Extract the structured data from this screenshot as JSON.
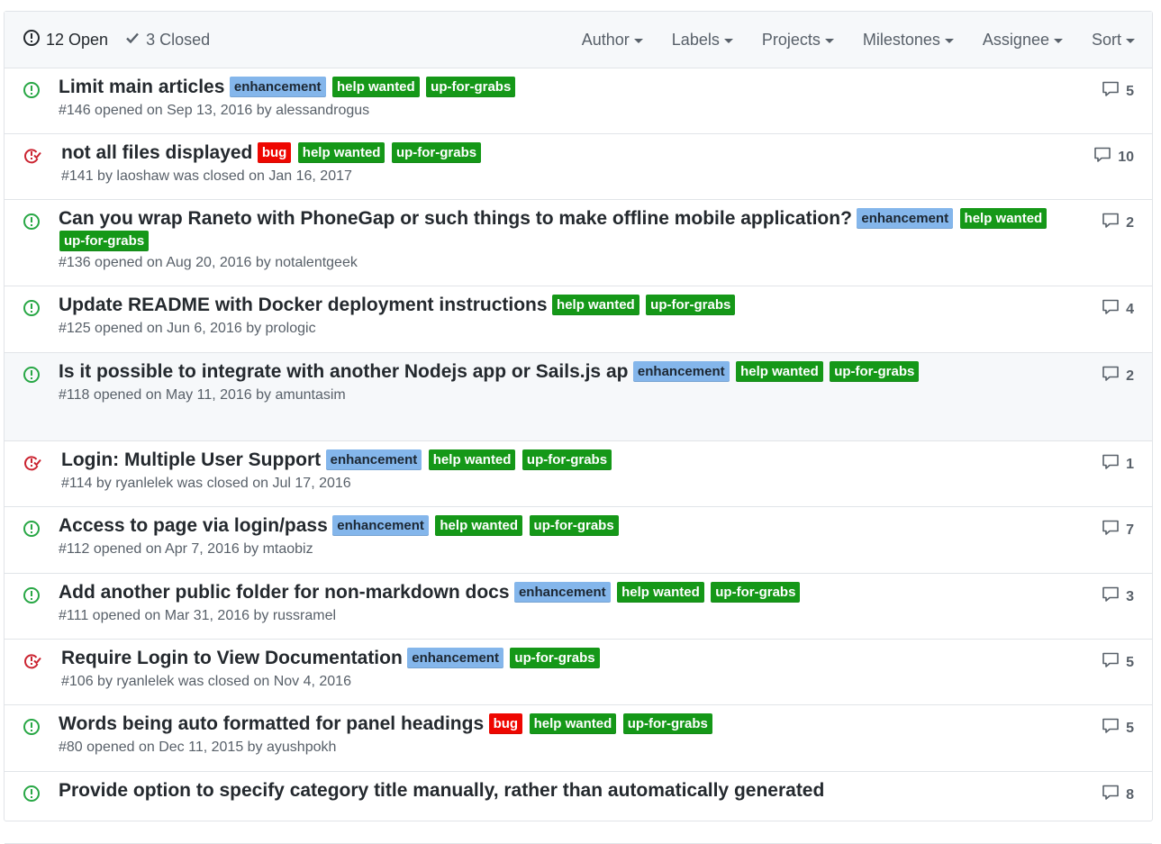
{
  "header": {
    "open_count": "12 Open",
    "closed_count": "3 Closed",
    "filters": [
      "Author",
      "Labels",
      "Projects",
      "Milestones",
      "Assignee",
      "Sort"
    ]
  },
  "colors": {
    "open_icon": "#28a745",
    "closed_icon": "#cb2431",
    "enhancement": "#84b6eb",
    "help_wanted": "#159818",
    "up_for_grabs": "#159818",
    "bug": "#ee0701"
  },
  "issues": [
    {
      "state": "open",
      "title": "Limit main articles",
      "labels": [
        "enhancement",
        "help wanted",
        "up-for-grabs"
      ],
      "meta": "#146 opened on Sep 13, 2016 by alessandrogus",
      "comments": "5"
    },
    {
      "state": "closed",
      "title": "not all files displayed",
      "labels": [
        "bug",
        "help wanted",
        "up-for-grabs"
      ],
      "meta": "#141 by laoshaw was closed on Jan 16, 2017",
      "comments": "10"
    },
    {
      "state": "open",
      "title": "Can you wrap Raneto with PhoneGap or such things to make offline mobile application?",
      "labels": [
        "enhancement",
        "help wanted",
        "up-for-grabs"
      ],
      "meta": "#136 opened on Aug 20, 2016 by notalentgeek",
      "comments": "2"
    },
    {
      "state": "open",
      "title": "Update README with Docker deployment instructions",
      "labels": [
        "help wanted",
        "up-for-grabs"
      ],
      "meta": "#125 opened on Jun 6, 2016 by prologic",
      "comments": "4"
    },
    {
      "state": "open",
      "title": "Is it possible to integrate with another Nodejs app or Sails.js ap",
      "labels": [
        "enhancement",
        "help wanted",
        "up-for-grabs"
      ],
      "meta": "#118 opened on May 11, 2016 by amuntasim",
      "comments": "2"
    },
    {
      "state": "closed",
      "title": "Login: Multiple User Support",
      "labels": [
        "enhancement",
        "help wanted",
        "up-for-grabs"
      ],
      "meta": "#114 by ryanlelek was closed on Jul 17, 2016",
      "comments": "1"
    },
    {
      "state": "open",
      "title": "Access to page via login/pass",
      "labels": [
        "enhancement",
        "help wanted",
        "up-for-grabs"
      ],
      "meta": "#112 opened on Apr 7, 2016 by mtaobiz",
      "comments": "7"
    },
    {
      "state": "open",
      "title": "Add another public folder for non-markdown docs",
      "labels": [
        "enhancement",
        "help wanted",
        "up-for-grabs"
      ],
      "meta": "#111 opened on Mar 31, 2016 by russramel",
      "comments": "3"
    },
    {
      "state": "closed",
      "title": "Require Login to View Documentation",
      "labels": [
        "enhancement",
        "up-for-grabs"
      ],
      "meta": "#106 by ryanlelek was closed on Nov 4, 2016",
      "comments": "5"
    },
    {
      "state": "open",
      "title": "Words being auto formatted for panel headings",
      "labels": [
        "bug",
        "help wanted",
        "up-for-grabs"
      ],
      "meta": "#80 opened on Dec 11, 2015 by ayushpokh",
      "comments": "5"
    },
    {
      "state": "open",
      "title": "Provide option to specify category title manually, rather than automatically generated",
      "labels": [],
      "meta": "",
      "comments": "8"
    }
  ]
}
